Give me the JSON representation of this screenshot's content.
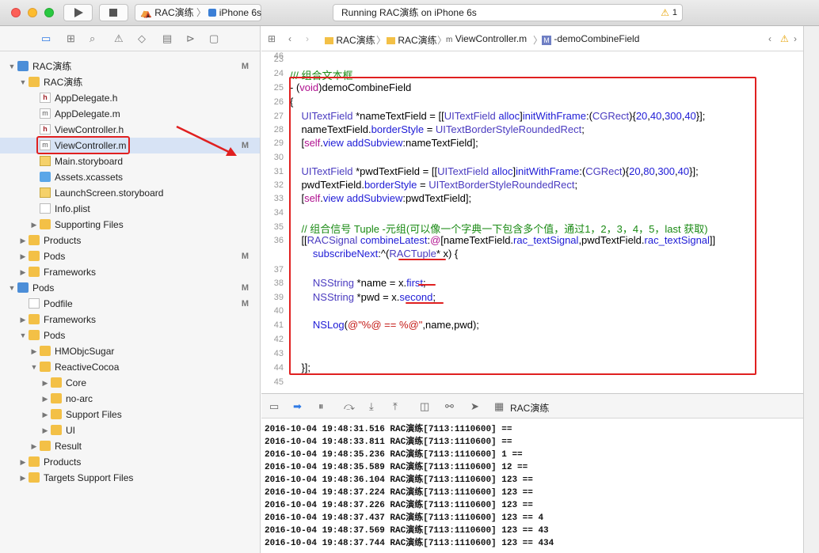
{
  "toolbar": {
    "scheme_name": "RAC演练",
    "device": "iPhone 6s",
    "status_text": "Running RAC演练 on iPhone 6s",
    "warning_count": "1"
  },
  "navigator": {
    "rows": [
      {
        "label": "RAC演练",
        "badge": "M",
        "indent": 0,
        "icon": "proj",
        "disc": "▼"
      },
      {
        "label": "RAC演练",
        "badge": "",
        "indent": 1,
        "icon": "folder",
        "disc": "▼"
      },
      {
        "label": "AppDelegate.h",
        "badge": "",
        "indent": 2,
        "icon": "fileh",
        "disc": ""
      },
      {
        "label": "AppDelegate.m",
        "badge": "",
        "indent": 2,
        "icon": "filem",
        "disc": ""
      },
      {
        "label": "ViewController.h",
        "badge": "",
        "indent": 2,
        "icon": "fileh",
        "disc": ""
      },
      {
        "label": "ViewController.m",
        "badge": "M",
        "indent": 2,
        "icon": "filem",
        "disc": "",
        "selected": true
      },
      {
        "label": "Main.storyboard",
        "badge": "",
        "indent": 2,
        "icon": "storyb",
        "disc": ""
      },
      {
        "label": "Assets.xcassets",
        "badge": "",
        "indent": 2,
        "icon": "assets",
        "disc": ""
      },
      {
        "label": "LaunchScreen.storyboard",
        "badge": "",
        "indent": 2,
        "icon": "storyb",
        "disc": ""
      },
      {
        "label": "Info.plist",
        "badge": "",
        "indent": 2,
        "icon": "plist",
        "disc": ""
      },
      {
        "label": "Supporting Files",
        "badge": "",
        "indent": 2,
        "icon": "folder",
        "disc": "▶"
      },
      {
        "label": "Products",
        "badge": "",
        "indent": 1,
        "icon": "folder",
        "disc": "▶"
      },
      {
        "label": "Pods",
        "badge": "M",
        "indent": 1,
        "icon": "folder",
        "disc": "▶"
      },
      {
        "label": "Frameworks",
        "badge": "",
        "indent": 1,
        "icon": "folder",
        "disc": "▶"
      },
      {
        "label": "Pods",
        "badge": "M",
        "indent": 0,
        "icon": "proj",
        "disc": "▼"
      },
      {
        "label": "Podfile",
        "badge": "M",
        "indent": 1,
        "icon": "plist",
        "disc": ""
      },
      {
        "label": "Frameworks",
        "badge": "",
        "indent": 1,
        "icon": "folder",
        "disc": "▶"
      },
      {
        "label": "Pods",
        "badge": "",
        "indent": 1,
        "icon": "folder",
        "disc": "▼"
      },
      {
        "label": "HMObjcSugar",
        "badge": "",
        "indent": 2,
        "icon": "folder",
        "disc": "▶"
      },
      {
        "label": "ReactiveCocoa",
        "badge": "",
        "indent": 2,
        "icon": "folder",
        "disc": "▼"
      },
      {
        "label": "Core",
        "badge": "",
        "indent": 3,
        "icon": "folder",
        "disc": "▶"
      },
      {
        "label": "no-arc",
        "badge": "",
        "indent": 3,
        "icon": "folder",
        "disc": "▶"
      },
      {
        "label": "Support Files",
        "badge": "",
        "indent": 3,
        "icon": "folder",
        "disc": "▶"
      },
      {
        "label": "UI",
        "badge": "",
        "indent": 3,
        "icon": "folder",
        "disc": "▶"
      },
      {
        "label": "Result",
        "badge": "",
        "indent": 2,
        "icon": "folder",
        "disc": "▶"
      },
      {
        "label": "Products",
        "badge": "",
        "indent": 1,
        "icon": "folder",
        "disc": "▶"
      },
      {
        "label": "Targets Support Files",
        "badge": "",
        "indent": 1,
        "icon": "folder",
        "disc": "▶"
      }
    ]
  },
  "jumpbar": {
    "crumb1": "RAC演练",
    "crumb2": "RAC演练",
    "crumb3": "ViewController.m",
    "crumb4": "-demoCombineField"
  },
  "code_lines": [
    {
      "n": "23",
      "html": ""
    },
    {
      "n": "24",
      "html": "<span class=\"cm\">///  组合文本框</span>"
    },
    {
      "n": "25",
      "html": "- (<span class=\"kw\">void</span>)demoCombineField"
    },
    {
      "n": "26",
      "html": "{"
    },
    {
      "n": "27",
      "html": "    <span class=\"ty\">UITextField</span> *nameTextField = [[<span class=\"ty\">UITextField</span> <span class=\"nm\">alloc</span>]<span class=\"nm\">initWithFrame</span>:(<span class=\"ty\">CGRect</span>){<span class=\"nm\">20</span>,<span class=\"nm\">40</span>,<span class=\"nm\">300</span>,<span class=\"nm\">40</span>}];"
    },
    {
      "n": "28",
      "html": "    nameTextField.<span class=\"nm\">borderStyle</span> = <span class=\"ty\">UITextBorderStyleRoundedRect</span>;"
    },
    {
      "n": "29",
      "html": "    [<span class=\"kw\">self</span>.<span class=\"nm\">view</span> <span class=\"nm\">addSubview</span>:nameTextField];"
    },
    {
      "n": "30",
      "html": ""
    },
    {
      "n": "31",
      "html": "    <span class=\"ty\">UITextField</span> *pwdTextField = [[<span class=\"ty\">UITextField</span> <span class=\"nm\">alloc</span>]<span class=\"nm\">initWithFrame</span>:(<span class=\"ty\">CGRect</span>){<span class=\"nm\">20</span>,<span class=\"nm\">80</span>,<span class=\"nm\">300</span>,<span class=\"nm\">40</span>}];"
    },
    {
      "n": "32",
      "html": "    pwdTextField.<span class=\"nm\">borderStyle</span> = <span class=\"ty\">UITextBorderStyleRoundedRect</span>;"
    },
    {
      "n": "33",
      "html": "    [<span class=\"kw\">self</span>.<span class=\"nm\">view</span> <span class=\"nm\">addSubview</span>:pwdTextField];"
    },
    {
      "n": "34",
      "html": ""
    },
    {
      "n": "35",
      "html": "    <span class=\"cm\">//  组合信号  Tuple -元组(可以像一个字典一下包含多个值，通过1，2，3，4，5，last 获取)</span>"
    },
    {
      "n": "36",
      "html": "    [[<span class=\"ty\">RACSignal</span> <span class=\"nm\">combineLatest</span>:<span class=\"kw\">@</span>[nameTextField.<span class=\"nm\">rac_textSignal</span>,pwdTextField.<span class=\"nm\">rac_textSignal</span>]]"
    },
    {
      "n": "",
      "html": "        <span class=\"nm\">subscribeNext</span>:^(<span class=\"ty\">RACTuple</span>* x) {"
    },
    {
      "n": "37",
      "html": ""
    },
    {
      "n": "38",
      "html": "        <span class=\"ty\">NSString</span> *name = x.<span class=\"nm\">first</span>;"
    },
    {
      "n": "39",
      "html": "        <span class=\"ty\">NSString</span> *pwd = x.<span class=\"nm\">second</span>;"
    },
    {
      "n": "40",
      "html": ""
    },
    {
      "n": "41",
      "html": "        <span class=\"nm\">NSLog</span>(<span class=\"st\">@\"%@ == %@\"</span>,name,pwd);"
    },
    {
      "n": "42",
      "html": ""
    },
    {
      "n": "43",
      "html": ""
    },
    {
      "n": "44",
      "html": "    }];"
    },
    {
      "n": "45",
      "html": ""
    },
    {
      "n": "46",
      "html": ""
    }
  ],
  "debug": {
    "target": "RAC演练"
  },
  "console_lines": [
    "2016-10-04 19:48:31.516 RAC演练[7113:1110600]  ==",
    "2016-10-04 19:48:33.811 RAC演练[7113:1110600]  ==",
    "2016-10-04 19:48:35.236 RAC演练[7113:1110600] 1 ==",
    "2016-10-04 19:48:35.589 RAC演练[7113:1110600] 12 ==",
    "2016-10-04 19:48:36.104 RAC演练[7113:1110600] 123 ==",
    "2016-10-04 19:48:37.224 RAC演练[7113:1110600] 123 ==",
    "2016-10-04 19:48:37.226 RAC演练[7113:1110600] 123 ==",
    "2016-10-04 19:48:37.437 RAC演练[7113:1110600] 123 == 4",
    "2016-10-04 19:48:37.569 RAC演练[7113:1110600] 123 == 43",
    "2016-10-04 19:48:37.744 RAC演练[7113:1110600] 123 == 434"
  ],
  "colors": {
    "annotation_red": "#e02020",
    "selection": "#d7e3f5"
  }
}
